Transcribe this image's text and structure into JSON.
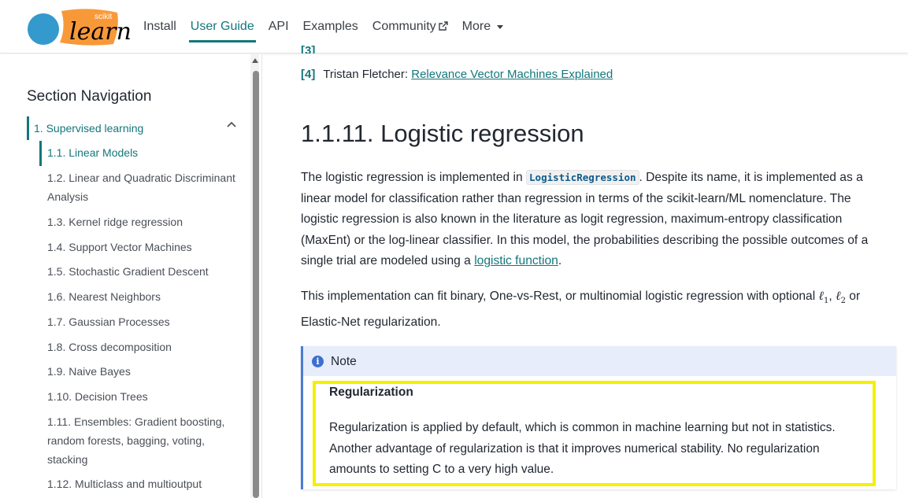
{
  "nav": {
    "logo_text": "learn",
    "logo_super": "scikit",
    "items": [
      "Install",
      "User Guide",
      "API",
      "Examples",
      "Community",
      "More"
    ],
    "active": "User Guide"
  },
  "sidebar": {
    "title": "Section Navigation",
    "group_label": "1. Supervised learning",
    "items": [
      "1.1. Linear Models",
      "1.2. Linear and Quadratic Discriminant Analysis",
      "1.3. Kernel ridge regression",
      "1.4. Support Vector Machines",
      "1.5. Stochastic Gradient Descent",
      "1.6. Nearest Neighbors",
      "1.7. Gaussian Processes",
      "1.8. Cross decomposition",
      "1.9. Naive Bayes",
      "1.10. Decision Trees",
      "1.11. Ensembles: Gradient boosting, random forests, bagging, voting, stacking",
      "1.12. Multiclass and multioutput"
    ]
  },
  "content": {
    "ref_partial_num": "[3]",
    "ref_num": "[4]",
    "ref_author": "Tristan Fletcher:",
    "ref_link": "Relevance Vector Machines Explained",
    "heading": "1.1.11. Logistic regression",
    "p1_start": "The logistic regression is implemented in",
    "p1_code": "LogisticRegression",
    "p1_rest": ". Despite its name, it is implemented as a linear model for classification rather than regression in terms of the scikit-learn/ML nomenclature. The logistic regression is also known in the literature as logit regression, maximum-entropy classification (MaxEnt) or the log-linear classifier. In this model, the probabilities describing the possible outcomes of a single trial are modeled using a",
    "p1_link": "logistic function",
    "p1_end": ".",
    "p2_start": "This implementation can fit binary, One-vs-Rest, or multinomial logistic regression with optional",
    "p2_math1": "ℓ",
    "p2_math1_sub": "1",
    "p2_math2": "ℓ",
    "p2_math2_sub": "2",
    "p2_or": "or",
    "p2_end": "Elastic-Net regularization.",
    "note_label": "Note",
    "note_icon": "i",
    "note_subtitle": "Regularization",
    "note_body": "Regularization is applied by default, which is common in machine learning but not in statistics. Another advantage of regularization is that it improves numerical stability. No regularization amounts to setting C to a very high value."
  }
}
